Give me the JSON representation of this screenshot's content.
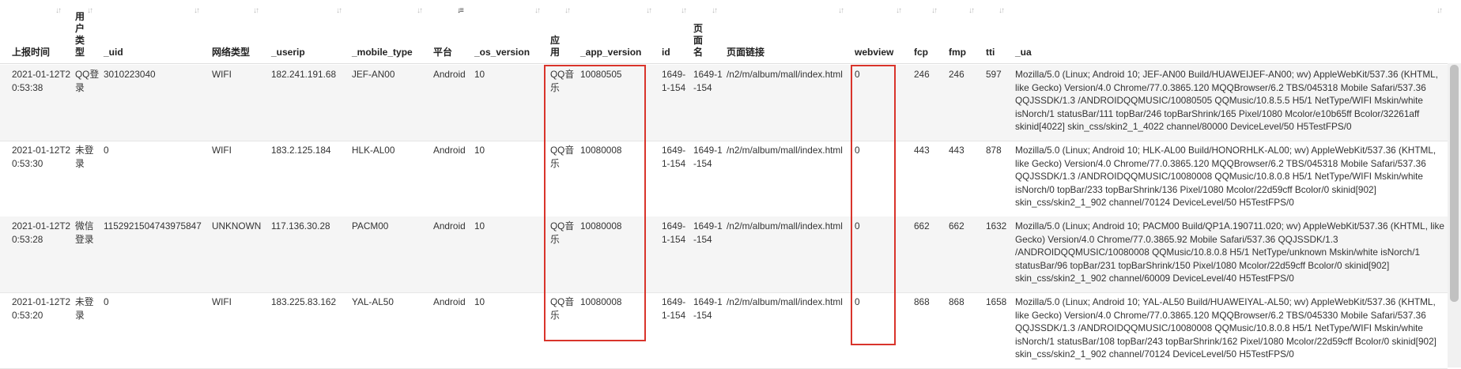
{
  "columns": [
    {
      "key": "report_time",
      "title": "上报时间",
      "sort": "none"
    },
    {
      "key": "user_type",
      "title": "用户类型",
      "sort": "none"
    },
    {
      "key": "uid",
      "title": "_uid",
      "sort": "none"
    },
    {
      "key": "network",
      "title": "网络类型",
      "sort": "none"
    },
    {
      "key": "userip",
      "title": "_userip",
      "sort": "none"
    },
    {
      "key": "mobile_type",
      "title": "_mobile_type",
      "sort": "none"
    },
    {
      "key": "platform",
      "title": "平台",
      "sort": "desc"
    },
    {
      "key": "os_version",
      "title": "_os_version",
      "sort": "none"
    },
    {
      "key": "app",
      "title": "应用",
      "sort": "none"
    },
    {
      "key": "app_version",
      "title": "_app_version",
      "sort": "none"
    },
    {
      "key": "id",
      "title": "id",
      "sort": "none"
    },
    {
      "key": "page_name",
      "title": "页面名",
      "sort": "none"
    },
    {
      "key": "page_link",
      "title": "页面链接",
      "sort": "none"
    },
    {
      "key": "webview",
      "title": "webview",
      "sort": "none"
    },
    {
      "key": "fcp",
      "title": "fcp",
      "sort": "none"
    },
    {
      "key": "fmp",
      "title": "fmp",
      "sort": "none"
    },
    {
      "key": "tti",
      "title": "tti",
      "sort": "none"
    },
    {
      "key": "ua",
      "title": "_ua",
      "sort": "none"
    }
  ],
  "rows": [
    {
      "report_time": "2021-01-12T20:53:38",
      "user_type": "QQ登录",
      "uid": "3010223040",
      "network": "WIFI",
      "userip": "182.241.191.68",
      "mobile_type": "JEF-AN00",
      "platform": "Android",
      "os_version": "10",
      "app": "QQ音乐",
      "app_version": "10080505",
      "id": "1649-1-154",
      "page_name": "1649-1-154",
      "page_link": "/n2/m/album/mall/index.html",
      "webview": "0",
      "fcp": "246",
      "fmp": "246",
      "tti": "597",
      "ua": "Mozilla/5.0 (Linux; Android 10; JEF-AN00 Build/HUAWEIJEF-AN00; wv) AppleWebKit/537.36 (KHTML, like Gecko) Version/4.0 Chrome/77.0.3865.120 MQQBrowser/6.2 TBS/045318 Mobile Safari/537.36 QQJSSDK/1.3 /ANDROIDQQMUSIC/10080505 QQMusic/10.8.5.5 H5/1 NetType/WIFI Mskin/white isNorch/1 statusBar/111 topBar/246 topBarShrink/165 Pixel/1080 Mcolor/e10b65ff Bcolor/32261aff  skinid[4022] skin_css/skin2_1_4022 channel/80000 DeviceLevel/50 H5TestFPS/0"
    },
    {
      "report_time": "2021-01-12T20:53:30",
      "user_type": "未登录",
      "uid": "0",
      "network": "WIFI",
      "userip": "183.2.125.184",
      "mobile_type": "HLK-AL00",
      "platform": "Android",
      "os_version": "10",
      "app": "QQ音乐",
      "app_version": "10080008",
      "id": "1649-1-154",
      "page_name": "1649-1-154",
      "page_link": "/n2/m/album/mall/index.html",
      "webview": "0",
      "fcp": "443",
      "fmp": "443",
      "tti": "878",
      "ua": "Mozilla/5.0 (Linux; Android 10; HLK-AL00 Build/HONORHLK-AL00; wv) AppleWebKit/537.36 (KHTML, like Gecko) Version/4.0 Chrome/77.0.3865.120 MQQBrowser/6.2 TBS/045318 Mobile Safari/537.36 QQJSSDK/1.3 /ANDROIDQQMUSIC/10080008 QQMusic/10.8.0.8 H5/1 NetType/WIFI Mskin/white isNorch/0 topBar/233 topBarShrink/136 Pixel/1080 Mcolor/22d59cff  Bcolor/0  skinid[902] skin_css/skin2_1_902 channel/70124 DeviceLevel/50 H5TestFPS/0"
    },
    {
      "report_time": "2021-01-12T20:53:28",
      "user_type": "微信登录",
      "uid": "1152921504743975847",
      "network": "UNKNOWN",
      "userip": "117.136.30.28",
      "mobile_type": "PACM00",
      "platform": "Android",
      "os_version": "10",
      "app": "QQ音乐",
      "app_version": "10080008",
      "id": "1649-1-154",
      "page_name": "1649-1-154",
      "page_link": "/n2/m/album/mall/index.html",
      "webview": "0",
      "fcp": "662",
      "fmp": "662",
      "tti": "1632",
      "ua": "Mozilla/5.0 (Linux; Android 10; PACM00 Build/QP1A.190711.020; wv) AppleWebKit/537.36 (KHTML, like Gecko) Version/4.0 Chrome/77.0.3865.92 Mobile Safari/537.36 QQJSSDK/1.3 /ANDROIDQQMUSIC/10080008 QQMusic/10.8.0.8 H5/1 NetType/unknown Mskin/white isNorch/1 statusBar/96 topBar/231 topBarShrink/150 Pixel/1080 Mcolor/22d59cff  Bcolor/0  skinid[902] skin_css/skin2_1_902 channel/60009 DeviceLevel/40 H5TestFPS/0"
    },
    {
      "report_time": "2021-01-12T20:53:20",
      "user_type": "未登录",
      "uid": "0",
      "network": "WIFI",
      "userip": "183.225.83.162",
      "mobile_type": "YAL-AL50",
      "platform": "Android",
      "os_version": "10",
      "app": "QQ音乐",
      "app_version": "10080008",
      "id": "1649-1-154",
      "page_name": "1649-1-154",
      "page_link": "/n2/m/album/mall/index.html",
      "webview": "0",
      "fcp": "868",
      "fmp": "868",
      "tti": "1658",
      "ua": "Mozilla/5.0 (Linux; Android 10; YAL-AL50 Build/HUAWEIYAL-AL50; wv) AppleWebKit/537.36 (KHTML, like Gecko) Version/4.0 Chrome/77.0.3865.120 MQQBrowser/6.2 TBS/045330 Mobile Safari/537.36 QQJSSDK/1.3 /ANDROIDQQMUSIC/10080008 QQMusic/10.8.0.8 H5/1 NetType/WIFI Mskin/white isNorch/1 statusBar/108 topBar/243 topBarShrink/162 Pixel/1080 Mcolor/22d59cff Bcolor/0  skinid[902] skin_css/skin2_1_902 channel/70124 DeviceLevel/50 H5TestFPS/0"
    }
  ],
  "icons": {
    "sort": "sort-icon",
    "sort_active": "sort-desc-icon"
  },
  "colors": {
    "highlight": "#d9342b",
    "row_alt": "#f5f5f5"
  }
}
